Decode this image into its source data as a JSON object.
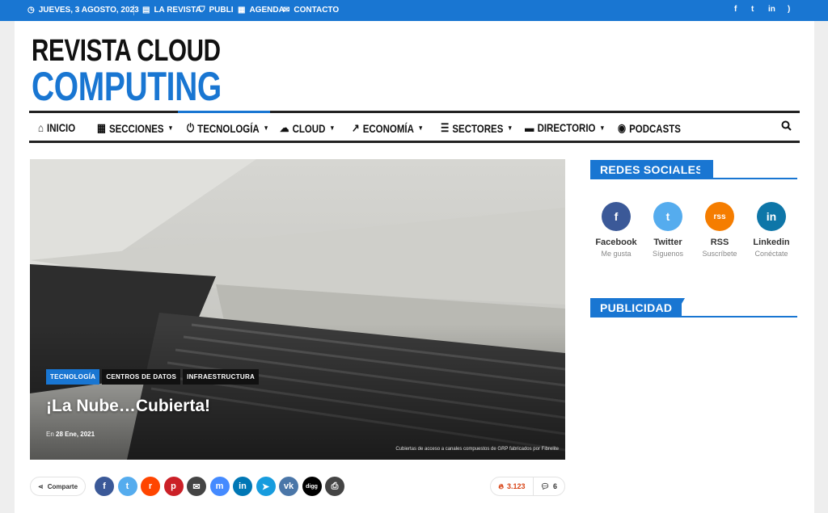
{
  "topbar": {
    "date": "JUEVES, 3 AGOSTO, 2023",
    "links": [
      {
        "label": "LA REVISTA",
        "icon": "newspaper-icon"
      },
      {
        "label": "PUBLI",
        "icon": "bookmark-icon"
      },
      {
        "label": "AGENDA",
        "icon": "calendar-icon"
      },
      {
        "label": "CONTACTO",
        "icon": "envelope-icon"
      }
    ],
    "social": [
      "facebook-icon",
      "twitter-icon",
      "linkedin-icon",
      "rss-icon"
    ],
    "color": "#1976d2"
  },
  "logo": {
    "line1": "REVISTA CLOUD",
    "line2": "COMPUTING"
  },
  "nav": {
    "items": [
      {
        "label": "INICIO",
        "icon": "home-icon"
      },
      {
        "label": "SECCIONES",
        "icon": "grid-icon"
      },
      {
        "label": "TECNOLOGÍA",
        "icon": "power-icon"
      },
      {
        "label": "CLOUD",
        "icon": "cloud-icon"
      },
      {
        "label": "ECONOMÍA",
        "icon": "chart-line-icon"
      },
      {
        "label": "SECTORES",
        "icon": "list-icon"
      },
      {
        "label": "DIRECTORIO",
        "icon": "folder-icon"
      },
      {
        "label": "PODCASTS",
        "icon": "podcast-icon"
      }
    ]
  },
  "article": {
    "tags": [
      "TECNOLOGÍA",
      "CENTROS DE DATOS",
      "INFRAESTRUCTURA"
    ],
    "title": "¡La Nube…Cubierta!",
    "date_prefix": "En",
    "date": "28 Ene, 2021",
    "caption": "Cubiertas de acceso a canales compuestos de GRP fabricados por Fibrelite"
  },
  "share": {
    "label": "Comparte",
    "networks": [
      {
        "name": "facebook-icon",
        "glyph": "f",
        "color": "#3b5998"
      },
      {
        "name": "twitter-icon",
        "glyph": "t",
        "color": "#55acee"
      },
      {
        "name": "reddit-icon",
        "glyph": "r",
        "color": "#ff4500"
      },
      {
        "name": "pinterest-icon",
        "glyph": "p",
        "color": "#cb2027"
      },
      {
        "name": "email-icon",
        "glyph": "✉",
        "color": "#444444"
      },
      {
        "name": "messenger-icon",
        "glyph": "m",
        "color": "#448aff"
      },
      {
        "name": "linkedin-icon",
        "glyph": "in",
        "color": "#0077b5"
      },
      {
        "name": "telegram-icon",
        "glyph": "➤",
        "color": "#179cde"
      },
      {
        "name": "vk-icon",
        "glyph": "vk",
        "color": "#4a76a8"
      },
      {
        "name": "digg-icon",
        "glyph": "digg",
        "color": "#000000"
      },
      {
        "name": "print-icon",
        "glyph": "⎙",
        "color": "#444444"
      }
    ],
    "views": "3.123",
    "comments": "6"
  },
  "sidebar": {
    "social_title": "REDES SOCIALES",
    "social": [
      {
        "name": "Facebook",
        "sub": "Me gusta",
        "glyph": "f",
        "color": "#3b5998",
        "icon": "facebook-icon"
      },
      {
        "name": "Twitter",
        "sub": "Síguenos",
        "glyph": "t",
        "color": "#55acee",
        "icon": "twitter-icon"
      },
      {
        "name": "RSS",
        "sub": "Suscríbete",
        "glyph": "rss",
        "color": "#f57d00",
        "icon": "rss-icon"
      },
      {
        "name": "Linkedin",
        "sub": "Conéctate",
        "glyph": "in",
        "color": "#0e76a8",
        "icon": "linkedin-icon"
      }
    ],
    "ad_title": "PUBLICIDAD"
  }
}
